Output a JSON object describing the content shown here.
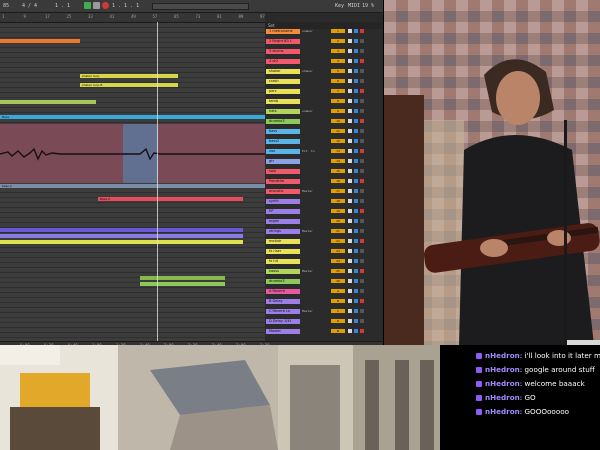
{
  "daw": {
    "toolbar": {
      "tempo": "85",
      "signature": "4 / 4",
      "bar": "1 . 1",
      "position": "1 . 1 . 1",
      "key_label": "Key",
      "midi_label": "MIDI",
      "cpu": "19 %"
    },
    "ruler_ticks": [
      "1",
      "9",
      "17",
      "25",
      "33",
      "41",
      "49",
      "57",
      "65",
      "73",
      "81",
      "89",
      "97"
    ],
    "bottom_ticks": [
      "0:00",
      "0:20",
      "0:40",
      "1:00",
      "1:20",
      "1:40",
      "2:00",
      "2:20",
      "2:40",
      "3:00",
      "3:20"
    ],
    "clips": {
      "c1": "Bass",
      "c2": "Bass",
      "c3": "shaker loop",
      "c4": "shaker loop B",
      "c5": "Bass",
      "c6": "Bass",
      "c7": "bass 2",
      "c8": "Bass 2",
      "c9": "Bass 2"
    },
    "mixer_header": "Set",
    "tracks": [
      {
        "name": "1 metronome",
        "color": "#f58c3c",
        "num": "1"
      },
      {
        "name": "2 Bright B3 L",
        "color": "#f05a6a",
        "num": "2"
      },
      {
        "name": "3 drums",
        "color": "#f05a6a",
        "num": "3"
      },
      {
        "name": "4 dr2",
        "color": "#f05a6a",
        "num": "4"
      },
      {
        "name": "shaker",
        "color": "#e8e056",
        "num": "5"
      },
      {
        "name": "crash",
        "color": "#e8e056",
        "num": "6"
      },
      {
        "name": "perc",
        "color": "#e8e056",
        "num": "7"
      },
      {
        "name": "tamb",
        "color": "#e8e056",
        "num": "8"
      },
      {
        "name": "hats",
        "color": "#b0d45c",
        "num": "9"
      },
      {
        "name": "drumbs3",
        "color": "#8cc85a",
        "num": "10"
      },
      {
        "name": "bass",
        "color": "#5ab4e6",
        "num": "11"
      },
      {
        "name": "bass2",
        "color": "#5ab4e6",
        "num": "12"
      },
      {
        "name": "vox",
        "color": "#5ab4e6",
        "num": "13"
      },
      {
        "name": "gtr",
        "color": "#8ca0e6",
        "num": "14"
      },
      {
        "name": "solo",
        "color": "#f05a6a",
        "num": "15"
      },
      {
        "name": "Pandeiro",
        "color": "#f05a6a",
        "num": "16"
      },
      {
        "name": "acoustic",
        "color": "#f05a6a",
        "num": "17"
      },
      {
        "name": "synth",
        "color": "#9b7ee6",
        "num": "18"
      },
      {
        "name": "EP",
        "color": "#9b7ee6",
        "num": "19"
      },
      {
        "name": "organ",
        "color": "#9b7ee6",
        "num": "20"
      },
      {
        "name": "strings",
        "color": "#9b7ee6",
        "num": "21"
      },
      {
        "name": "mellotr",
        "color": "#e8e056",
        "num": "22"
      },
      {
        "name": "fx riser",
        "color": "#e8e056",
        "num": "23"
      },
      {
        "name": "fx hit",
        "color": "#e8e056",
        "num": "24"
      },
      {
        "name": "kaoss",
        "color": "#b0d45c",
        "num": "25"
      },
      {
        "name": "drumbs3",
        "color": "#8cc85a",
        "num": "26"
      },
      {
        "name": "A Reverb",
        "color": "#e65aa0",
        "num": "A"
      },
      {
        "name": "B Delay",
        "color": "#9b7ee6",
        "num": "B"
      },
      {
        "name": "C Reverb Lo",
        "color": "#9b7ee6",
        "num": "C"
      },
      {
        "name": "D Delay 1/4t",
        "color": "#9b7ee6",
        "num": "D"
      },
      {
        "name": "Master",
        "color": "#9b7ee6",
        "num": "M"
      }
    ],
    "routing": {
      "r1": "snaker",
      "r2": "shaker",
      "r3": "snaker",
      "r4": "Ext. In",
      "r5": "Master",
      "r6": "Master",
      "r7": "Master",
      "r8": "Master",
      "r9": "1/2"
    }
  },
  "chat": {
    "messages": [
      {
        "user": "nHedron",
        "text": "i'll look into it later may"
      },
      {
        "user": "nHedron",
        "text": "google around stuff"
      },
      {
        "user": "nHedron",
        "text": "welcome baaack"
      },
      {
        "user": "nHedron",
        "text": "GO"
      },
      {
        "user": "nHedron",
        "text": "GOOOooooo"
      }
    ]
  }
}
